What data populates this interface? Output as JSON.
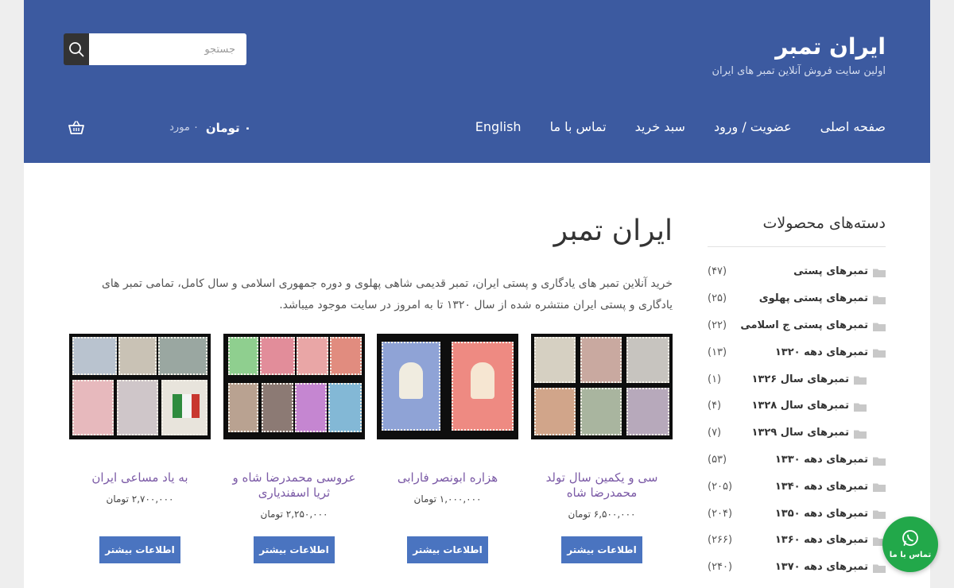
{
  "header": {
    "site_title": "ایران تمبر",
    "tagline": "اولین سایت فروش آنلاین تمبر های ایران",
    "search_placeholder": "جستجو",
    "nav": [
      "صفحه اصلی",
      "عضویت / ورود",
      "سبد خرید",
      "تماس با ما",
      "English"
    ],
    "cart_amount": "۰ تومان",
    "cart_count": "۰ مورد"
  },
  "sidebar": {
    "title": "دسته‌های محصولات",
    "categories": [
      {
        "label": "تمبرهای پستی",
        "count": "(۴۷)",
        "sub": false
      },
      {
        "label": "تمبرهای پستی پهلوی",
        "count": "(۲۵)",
        "sub": false
      },
      {
        "label": "تمبرهای پستی ج اسلامی",
        "count": "(۲۲)",
        "sub": false
      },
      {
        "label": "تمبرهای دهه ۱۳۲۰",
        "count": "(۱۳)",
        "sub": false
      },
      {
        "label": "تمبرهای سال ۱۳۲۶",
        "count": "(۱)",
        "sub": true
      },
      {
        "label": "تمبرهای سال ۱۳۲۸",
        "count": "(۴)",
        "sub": true
      },
      {
        "label": "تمبرهای سال ۱۳۲۹",
        "count": "(۷)",
        "sub": true
      },
      {
        "label": "تمبرهای دهه ۱۳۳۰",
        "count": "(۵۳)",
        "sub": false
      },
      {
        "label": "تمبرهای دهه ۱۳۴۰",
        "count": "(۲۰۵)",
        "sub": false
      },
      {
        "label": "تمبرهای دهه ۱۳۵۰",
        "count": "(۲۰۴)",
        "sub": false
      },
      {
        "label": "تمبرهای دهه ۱۳۶۰",
        "count": "(۲۶۶)",
        "sub": false
      },
      {
        "label": "تمبرهای دهه ۱۳۷۰",
        "count": "(۲۴۰)",
        "sub": false
      }
    ]
  },
  "main": {
    "title": "ایران تمبر",
    "description": "خرید آنلاین تمبر های یادگاری و پستی ایران، تمبر قدیمی شاهی پهلوی و دوره جمهوری اسلامی و سال کامل، تمامی تمبر های یادگاری و پستی ایران منتشره شده از سال ۱۳۲۰ تا به امروز در سایت موجود میباشد.",
    "products": [
      {
        "title": "سی و یکمین سال تولد محمدرضا شاه",
        "price": "۶,۵۰۰,۰۰۰ تومان",
        "button": "اطلاعات بیشتر"
      },
      {
        "title": "هزاره ابونصر فارابی",
        "price": "۱,۰۰۰,۰۰۰ تومان",
        "button": "اطلاعات بیشتر"
      },
      {
        "title": "عروسی محمدرضا شاه و ثریا اسفندیاری",
        "price": "۲,۲۵۰,۰۰۰ تومان",
        "button": "اطلاعات بیشتر"
      },
      {
        "title": "به یاد مساعی ایران",
        "price": "۲,۷۰۰,۰۰۰ تومان",
        "button": "اطلاعات بیشتر"
      }
    ]
  },
  "whatsapp": {
    "label": "تماس با ما"
  },
  "colors": {
    "header_bg": "#3c5aa0",
    "accent_button": "#4a74c0",
    "product_title": "#7b5aa6",
    "whatsapp": "#22a84a"
  }
}
